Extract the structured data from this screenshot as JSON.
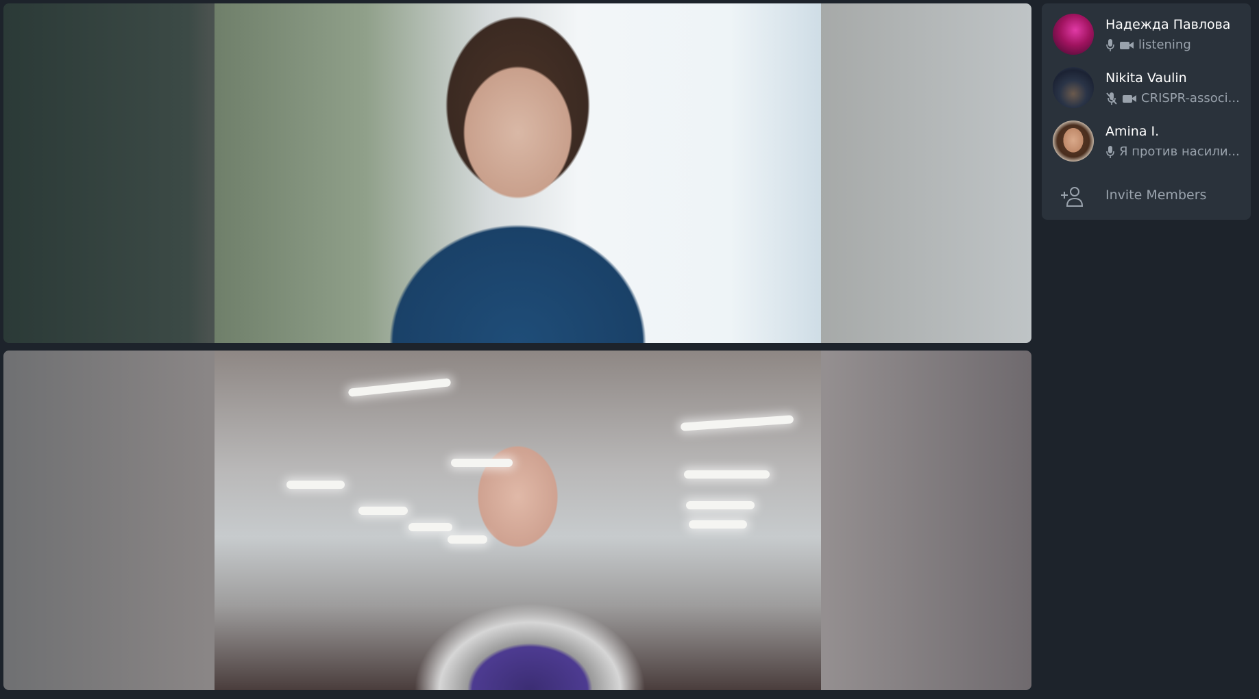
{
  "participants": [
    {
      "name": "Надежда Павлова",
      "status": "listening",
      "mic": "on",
      "camera": "on"
    },
    {
      "name": "Nikita Vaulin",
      "status": "CRISPR-associ...",
      "mic": "muted",
      "camera": "on"
    },
    {
      "name": "Amina I.",
      "status": "Я против насили...",
      "mic": "on",
      "camera": "off"
    }
  ],
  "invite": {
    "label": "Invite Members",
    "icon": "add-user-icon"
  },
  "colors": {
    "background": "#1d232b",
    "panel": "#2a323b",
    "text": "#ffffff",
    "muted": "#9aa3ad"
  }
}
